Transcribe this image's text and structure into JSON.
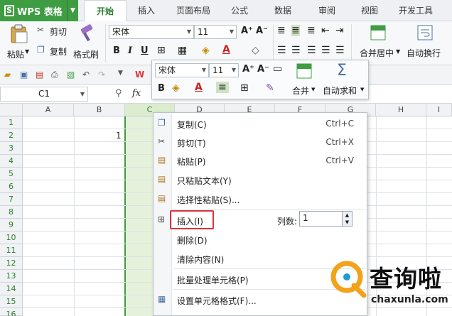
{
  "app": {
    "name": "WPS 表格",
    "logo": "S"
  },
  "tabs": [
    "开始",
    "插入",
    "页面布局",
    "公式",
    "数据",
    "审阅",
    "视图",
    "开发工具"
  ],
  "ribbon": {
    "cut": "剪切",
    "paste": "粘贴",
    "copy": "复制",
    "format_painter": "格式刷",
    "font": "宋体",
    "size": "11",
    "merge_center": "合并居中",
    "wrap": "自动换行"
  },
  "namebox": "C1",
  "fx": "fx",
  "columns": [
    "A",
    "B",
    "C",
    "D",
    "E",
    "F",
    "G",
    "H",
    "I"
  ],
  "rows": [
    "1",
    "2",
    "3",
    "4",
    "5",
    "6",
    "7",
    "8",
    "9",
    "10",
    "11",
    "12",
    "13",
    "14",
    "15",
    "16"
  ],
  "cell_b2": "1",
  "mini_toolbar": {
    "font": "宋体",
    "size": "11",
    "merge": "合并",
    "autosum": "自动求和"
  },
  "context_menu": {
    "items": [
      {
        "label": "复制(C)",
        "shortcut": "Ctrl+C",
        "icon": "copy-icon"
      },
      {
        "label": "剪切(T)",
        "shortcut": "Ctrl+X",
        "icon": "scissors-icon"
      },
      {
        "label": "粘贴(P)",
        "shortcut": "Ctrl+V",
        "icon": "paste-icon"
      },
      {
        "label": "只粘贴文本(Y)",
        "shortcut": "",
        "icon": "paste-text-icon"
      },
      {
        "label": "选择性粘贴(S)...",
        "shortcut": "",
        "icon": "paste-special-icon"
      },
      {
        "label": "插入(I)",
        "shortcut": "",
        "icon": "insert-icon"
      },
      {
        "label": "删除(D)",
        "shortcut": "",
        "icon": ""
      },
      {
        "label": "清除内容(N)",
        "shortcut": "",
        "icon": ""
      },
      {
        "label": "批量处理单元格(P)",
        "shortcut": "",
        "icon": ""
      },
      {
        "label": "设置单元格格式(F)...",
        "shortcut": "",
        "icon": "format-cells-icon"
      }
    ],
    "col_count_label": "列数:",
    "col_count_value": "1"
  },
  "watermark": {
    "title": "查询啦",
    "url": "chaxunla.com"
  },
  "colors": {
    "accent": "#3e9d42",
    "highlight": "#d9353d",
    "selection": "#e6f1dc"
  }
}
